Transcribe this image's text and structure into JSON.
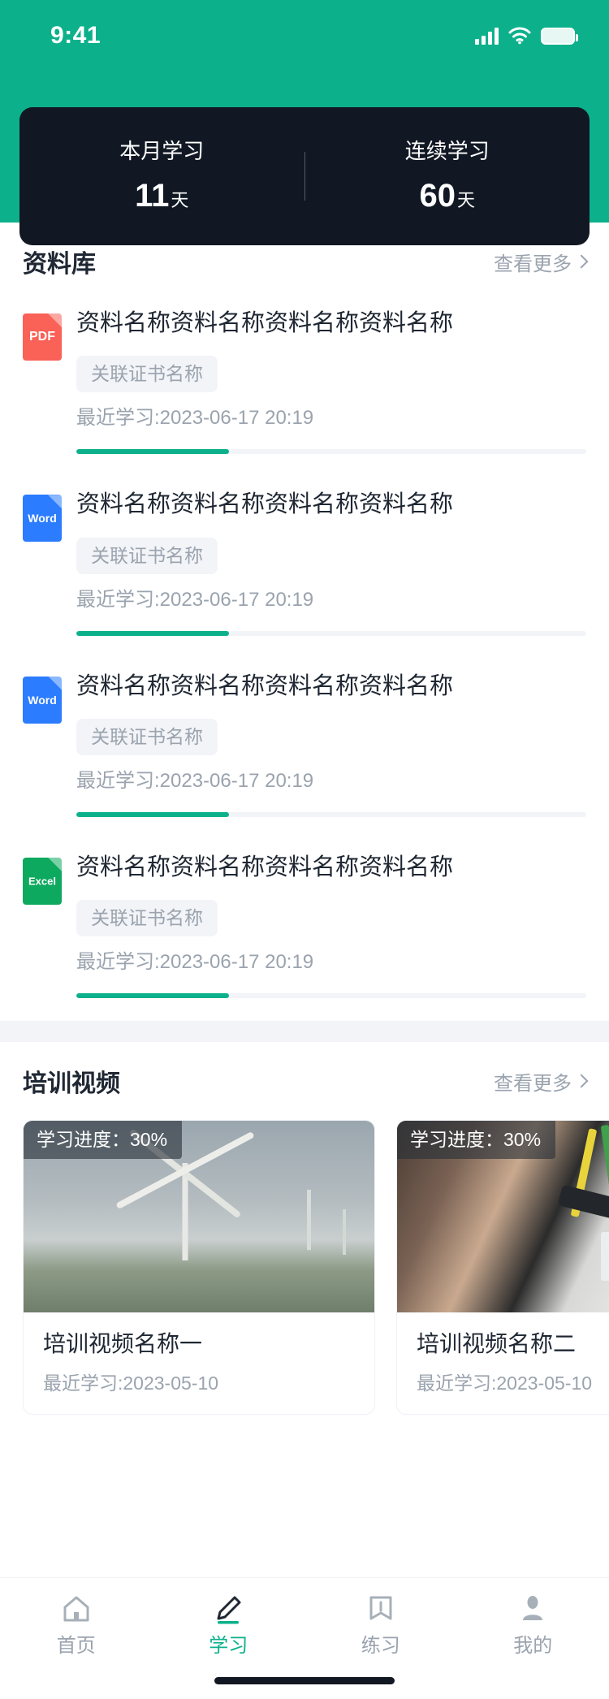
{
  "theme": {
    "accent": "#0CB18C",
    "dark_card": "#111823",
    "muted_text": "#9AA3AE",
    "title_text": "#1F2733",
    "divider_bg": "#F2F4F8"
  },
  "status_bar": {
    "time": "9:41",
    "signal_icon": "signal-bars-icon",
    "wifi_icon": "wifi-icon",
    "battery_icon": "battery-icon"
  },
  "stats": {
    "items": [
      {
        "label": "本月学习",
        "value": "11",
        "unit": "天"
      },
      {
        "label": "连续学习",
        "value": "60",
        "unit": "天"
      }
    ]
  },
  "library": {
    "title": "资料库",
    "more_label": "查看更多",
    "more_icon": "chevron-right-icon",
    "items": [
      {
        "file_type": "PDF",
        "icon": "pdf-file-icon",
        "icon_color": "#FA6157",
        "title": "资料名称资料名称资料名称资料名称",
        "badge": "关联证书名称",
        "time": "最近学习:2023-06-17 20:19",
        "progress": 30
      },
      {
        "file_type": "Word",
        "icon": "word-file-icon",
        "icon_color": "#2B7CFF",
        "title": "资料名称资料名称资料名称资料名称",
        "badge": "关联证书名称",
        "time": "最近学习:2023-06-17 20:19",
        "progress": 30
      },
      {
        "file_type": "Word",
        "icon": "word-file-icon",
        "icon_color": "#2B7CFF",
        "title": "资料名称资料名称资料名称资料名称",
        "badge": "关联证书名称",
        "time": "最近学习:2023-06-17 20:19",
        "progress": 30
      },
      {
        "file_type": "Excel",
        "icon": "excel-file-icon",
        "icon_color": "#0DA95F",
        "title": "资料名称资料名称资料名称资料名称",
        "badge": "关联证书名称",
        "time": "最近学习:2023-06-17 20:19",
        "progress": 30
      }
    ]
  },
  "videos": {
    "title": "培训视频",
    "more_label": "查看更多",
    "more_icon": "chevron-right-icon",
    "items": [
      {
        "progress_badge": "学习进度：30%",
        "title": "培训视频名称一",
        "time": "最近学习:2023-05-10",
        "thumbnail": "wind-turbines-photo"
      },
      {
        "progress_badge": "学习进度：30%",
        "title": "培训视频名称二",
        "time": "最近学习:2023-05-10",
        "thumbnail": "electrical-panel-photo"
      }
    ]
  },
  "tabbar": {
    "items": [
      {
        "label": "首页",
        "icon": "home-icon",
        "active": false
      },
      {
        "label": "学习",
        "icon": "pencil-icon",
        "active": true
      },
      {
        "label": "练习",
        "icon": "book-icon",
        "active": false
      },
      {
        "label": "我的",
        "icon": "person-icon",
        "active": false
      }
    ]
  }
}
